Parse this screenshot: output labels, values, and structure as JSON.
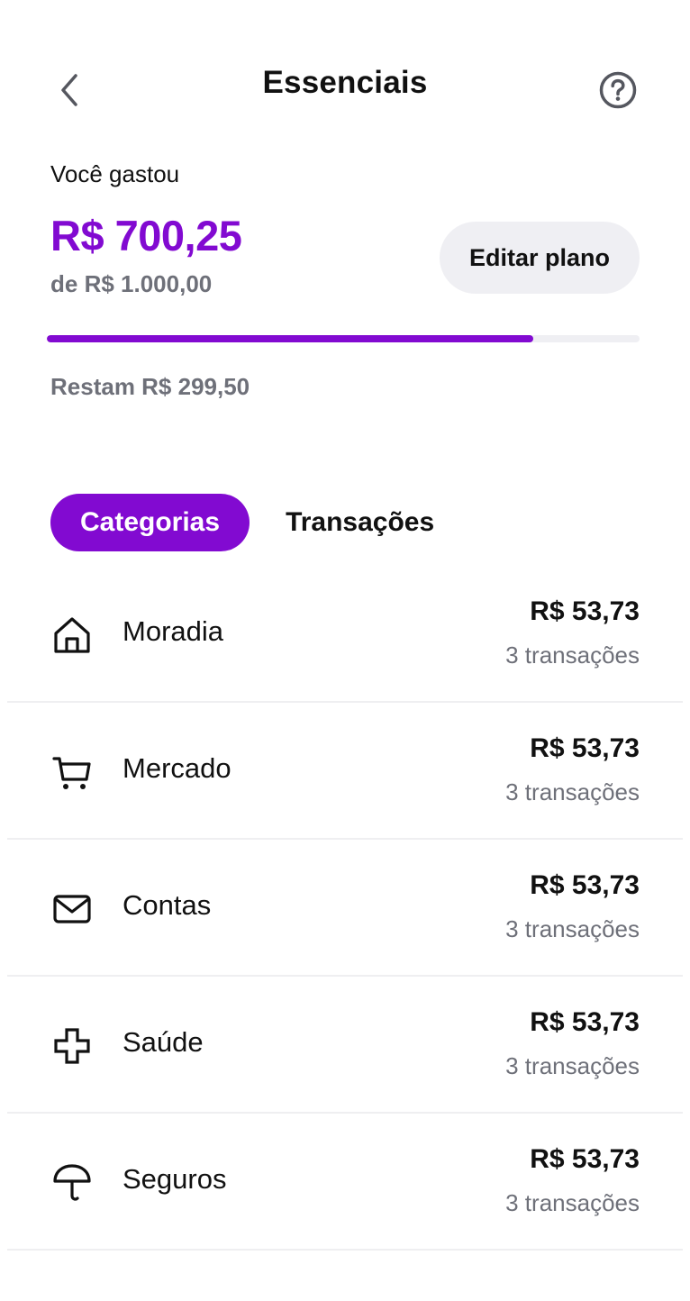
{
  "colors": {
    "accent": "#820ad1",
    "muted": "#6e7079",
    "track": "#efeff3"
  },
  "header": {
    "title": "Essenciais",
    "back_icon": "chevron-left-icon",
    "help_icon": "question-circle-icon"
  },
  "summary": {
    "spent_label": "Você gastou",
    "spent_amount": "R$ 700,25",
    "budget_total": "de R$ 1.000,00",
    "edit_button": "Editar plano",
    "progress_fraction": 0.82,
    "remaining": "Restam R$ 299,50"
  },
  "tabs": [
    {
      "label": "Categorias",
      "active": true
    },
    {
      "label": "Transações",
      "active": false
    }
  ],
  "categories": [
    {
      "icon": "house-icon",
      "name": "Moradia",
      "amount": "R$ 53,73",
      "count": "3 transações"
    },
    {
      "icon": "cart-icon",
      "name": "Mercado",
      "amount": "R$ 53,73",
      "count": "3 transações"
    },
    {
      "icon": "envelope-icon",
      "name": "Contas",
      "amount": "R$ 53,73",
      "count": "3 transações"
    },
    {
      "icon": "medical-cross-icon",
      "name": "Saúde",
      "amount": "R$ 53,73",
      "count": "3 transações"
    },
    {
      "icon": "umbrella-icon",
      "name": "Seguros",
      "amount": "R$ 53,73",
      "count": "3 transações"
    }
  ]
}
